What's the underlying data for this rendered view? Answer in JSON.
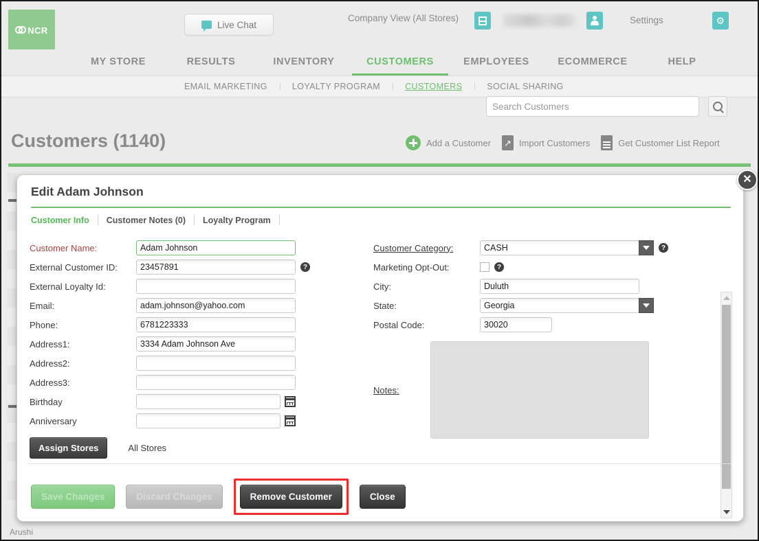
{
  "header": {
    "logo_text": "NCR",
    "live_chat_label": "Live Chat",
    "company_view": "Company View (All Stores)",
    "settings_label": "Settings",
    "store_icon": "store-icon",
    "user_icon": "user-icon",
    "gear_icon": "gear-icon"
  },
  "mainnav": [
    {
      "label": "MY STORE",
      "active": false
    },
    {
      "label": "RESULTS",
      "active": false
    },
    {
      "label": "INVENTORY",
      "active": false
    },
    {
      "label": "CUSTOMERS",
      "active": true
    },
    {
      "label": "EMPLOYEES",
      "active": false
    },
    {
      "label": "ECOMMERCE",
      "active": false
    },
    {
      "label": "HELP",
      "active": false
    }
  ],
  "subnav": [
    {
      "label": "EMAIL MARKETING",
      "active": false
    },
    {
      "label": "LOYALTY PROGRAM",
      "active": false
    },
    {
      "label": "CUSTOMERS",
      "active": true
    },
    {
      "label": "SOCIAL SHARING",
      "active": false
    }
  ],
  "search": {
    "placeholder": "Search Customers",
    "value": "",
    "button_icon": "search-icon"
  },
  "page": {
    "title": "Customers (1140)",
    "actions": [
      {
        "label": "Add a Customer",
        "icon": "plus-circle-icon"
      },
      {
        "label": "Import Customers",
        "icon": "import-arrow-icon"
      },
      {
        "label": "Get Customer List Report",
        "icon": "document-lines-icon"
      }
    ]
  },
  "modal": {
    "title": "Edit Adam Johnson",
    "close_icon": "close-icon",
    "tabs": [
      {
        "label": "Customer Info",
        "active": true
      },
      {
        "label": "Customer Notes (0)",
        "active": false
      },
      {
        "label": "Loyalty Program",
        "active": false
      }
    ],
    "left_fields": [
      {
        "label": "Customer Name:",
        "value": "Adam Johnson",
        "required": true
      },
      {
        "label": "External Customer ID:",
        "value": "23457891",
        "required": false
      },
      {
        "label": "External Loyalty Id:",
        "value": "",
        "required": false
      },
      {
        "label": "Email:",
        "value": "adam.johnson@yahoo.com",
        "required": false
      },
      {
        "label": "Phone:",
        "value": "6781223333",
        "required": false
      },
      {
        "label": "Address1:",
        "value": "3334 Adam Johnson Ave",
        "required": false
      },
      {
        "label": "Address2:",
        "value": "",
        "required": false
      },
      {
        "label": "Address3:",
        "value": "",
        "required": false
      },
      {
        "label": "Birthday",
        "value": "",
        "required": false
      },
      {
        "label": "Anniversary",
        "value": "",
        "required": false
      }
    ],
    "assign_stores_label": "Assign Stores",
    "all_stores_label": "All Stores",
    "right_fields": {
      "customer_category_label": "Customer Category:",
      "customer_category_value": "CASH",
      "marketing_optout_label": "Marketing Opt-Out:",
      "marketing_optout_checked": false,
      "city_label": "City:",
      "city_value": "Duluth",
      "state_label": "State:",
      "state_value": "Georgia",
      "postal_label": "Postal Code:",
      "postal_value": "30020",
      "notes_label": "Notes:",
      "notes_value": ""
    },
    "footer": {
      "save_label": "Save Changes",
      "discard_label": "Discard Changes",
      "remove_label": "Remove Customer",
      "close_label": "Close"
    }
  },
  "status_text": "Arushi",
  "colors": {
    "brand_green": "#6fc06f",
    "teal_icon": "#5ec5c5",
    "highlight_red": "#ee2b2b",
    "page_bg": "#ebebeb"
  }
}
